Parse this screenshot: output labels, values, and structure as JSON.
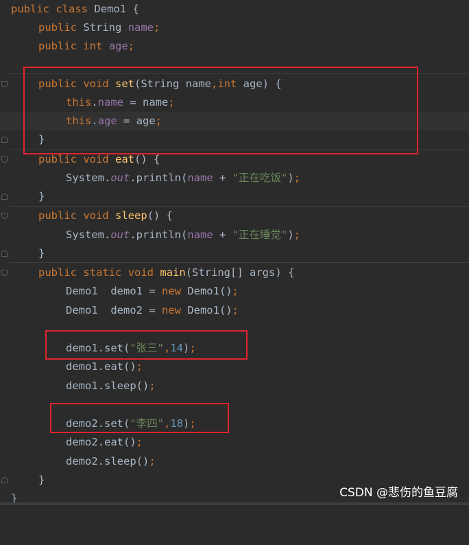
{
  "editor": {
    "lines": {
      "l1": {
        "kw1": "public",
        "kw2": "class",
        "name": "Demo1",
        "brace": " {"
      },
      "l2": {
        "kw": "public",
        "type": "String",
        "field": "name",
        "semi": ";"
      },
      "l3": {
        "kw": "public",
        "type": "int",
        "field": "age",
        "semi": ";"
      },
      "l5": {
        "kw1": "public",
        "kw2": "void",
        "fn": "set",
        "open": "(String name",
        "comma": ",",
        "kw3": "int",
        "rest": " age) {"
      },
      "l6": {
        "this": "this",
        "dot": ".",
        "field": "name",
        "rest": " = name",
        "semi": ";"
      },
      "l7": {
        "this": "this",
        "dot": ".",
        "field": "age",
        "rest": " = age",
        "semi": ";"
      },
      "l8": {
        "brace": "}"
      },
      "l9": {
        "kw1": "public",
        "kw2": "void",
        "fn": "eat",
        "rest": "() {"
      },
      "l10": {
        "obj": "System.",
        "st": "out",
        "call": ".println(",
        "fld": "name",
        "plus": " + ",
        "str": "\"正在吃饭\"",
        "end": ")",
        "semi": ";"
      },
      "l11": {
        "brace": "}"
      },
      "l12": {
        "kw1": "public",
        "kw2": "void",
        "fn": "sleep",
        "rest": "() {"
      },
      "l13": {
        "obj": "System.",
        "st": "out",
        "call": ".println(",
        "fld": "name",
        "plus": " + ",
        "str": "\"正在睡觉\"",
        "end": ")",
        "semi": ";"
      },
      "l14": {
        "brace": "}"
      },
      "l15": {
        "kw1": "public",
        "kw2": "static",
        "kw3": "void",
        "fn": "main",
        "rest": "(String[] args) {"
      },
      "l16": {
        "decl": "Demo1  demo1 = ",
        "kw": "new",
        "ctor": " Demo1()",
        "semi": ";"
      },
      "l17": {
        "decl": "Demo1  demo2 = ",
        "kw": "new",
        "ctor": " Demo1()",
        "semi": ";"
      },
      "l19": {
        "call": "demo1.set(",
        "str": "\"张三\"",
        "comma": ",",
        "num": "14",
        "end": ")",
        "semi": ";"
      },
      "l20": {
        "call": "demo1.eat()",
        "semi": ";"
      },
      "l21": {
        "call": "demo1.sleep()",
        "semi": ";"
      },
      "l23": {
        "call": "demo2.set(",
        "str": "\"李四\"",
        "comma": ",",
        "num": "18",
        "end": ")",
        "semi": ";"
      },
      "l24": {
        "call": "demo2.eat()",
        "semi": ";"
      },
      "l25": {
        "call": "demo2.sleep()",
        "semi": ";"
      },
      "l26": {
        "brace": "}"
      },
      "l27": {
        "brace": "}"
      }
    },
    "highlight_color": "#e0242f"
  },
  "watermark": "CSDN @悲伤的鱼豆腐"
}
